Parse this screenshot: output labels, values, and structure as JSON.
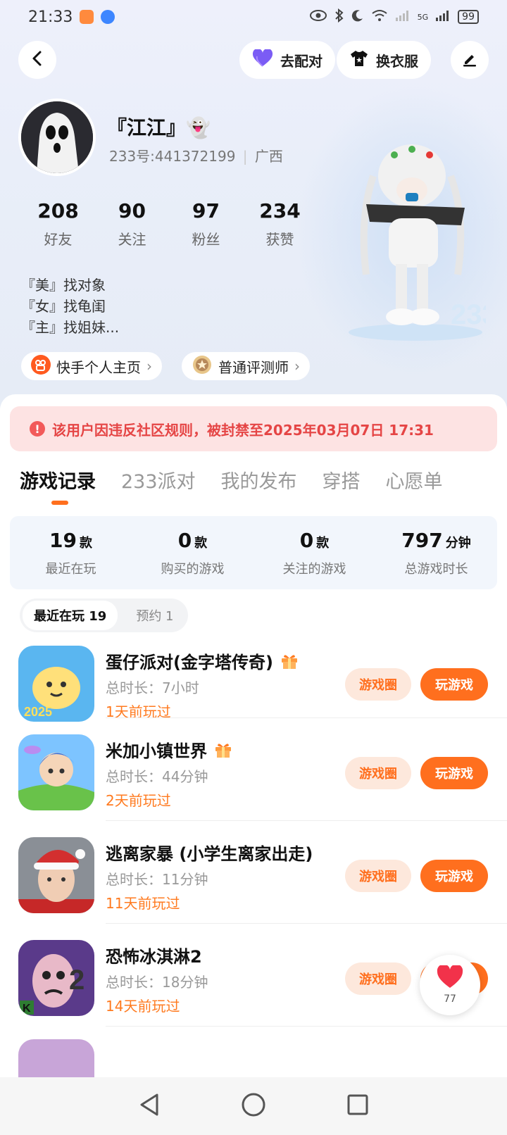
{
  "status_bar": {
    "time": "21:33",
    "network_label": "5G",
    "battery": "99"
  },
  "header": {
    "back_icon": "chevron-left-icon",
    "match_label": "去配对",
    "dress_label": "换衣服",
    "edit_icon": "pencil-icon"
  },
  "profile": {
    "nickname": "『江江』👻",
    "uid_line": "233号:441372199",
    "region": "广西",
    "stats": [
      {
        "value": "208",
        "label": "好友"
      },
      {
        "value": "90",
        "label": "关注"
      },
      {
        "value": "97",
        "label": "粉丝"
      },
      {
        "value": "234",
        "label": "获赞"
      }
    ],
    "bio_lines": [
      "『美』找对象",
      "『女』找龟闺",
      "『主』找姐妹..."
    ],
    "kuaishou_link": "快手个人主页",
    "reviewer_badge": "普通评测师"
  },
  "ban_notice": "该用户因违反社区规则，被封禁至2025年03月07日 17:31",
  "tabs": [
    "游戏记录",
    "233派对",
    "我的发布",
    "穿搭",
    "心愿单"
  ],
  "summary": [
    {
      "value": "19",
      "unit": "款",
      "label": "最近在玩"
    },
    {
      "value": "0",
      "unit": "款",
      "label": "购买的游戏"
    },
    {
      "value": "0",
      "unit": "款",
      "label": "关注的游戏"
    },
    {
      "value": "797",
      "unit": "分钟",
      "label": "总游戏时长"
    }
  ],
  "filters": {
    "recent": "最近在玩 19",
    "reserved": "预约 1"
  },
  "games": [
    {
      "title": "蛋仔派对(金字塔传奇)",
      "duration": "总时长：7小时",
      "last_played": "1天前玩过",
      "gift": true
    },
    {
      "title": "米加小镇世界",
      "duration": "总时长：44分钟",
      "last_played": "2天前玩过",
      "gift": true
    },
    {
      "title": "逃离家暴 (小学生离家出走)",
      "duration": "总时长：11分钟",
      "last_played": "11天前玩过",
      "gift": false
    },
    {
      "title": "恐怖冰淇淋2",
      "duration": "总时长：18分钟",
      "last_played": "14天前玩过",
      "gift": false
    }
  ],
  "buttons": {
    "circle": "游戏圈",
    "play": "玩游戏"
  },
  "like_count": "77",
  "colors": {
    "accent": "#ff6f1e",
    "ban_text": "#e54545",
    "ban_bg": "#fde3e3"
  }
}
